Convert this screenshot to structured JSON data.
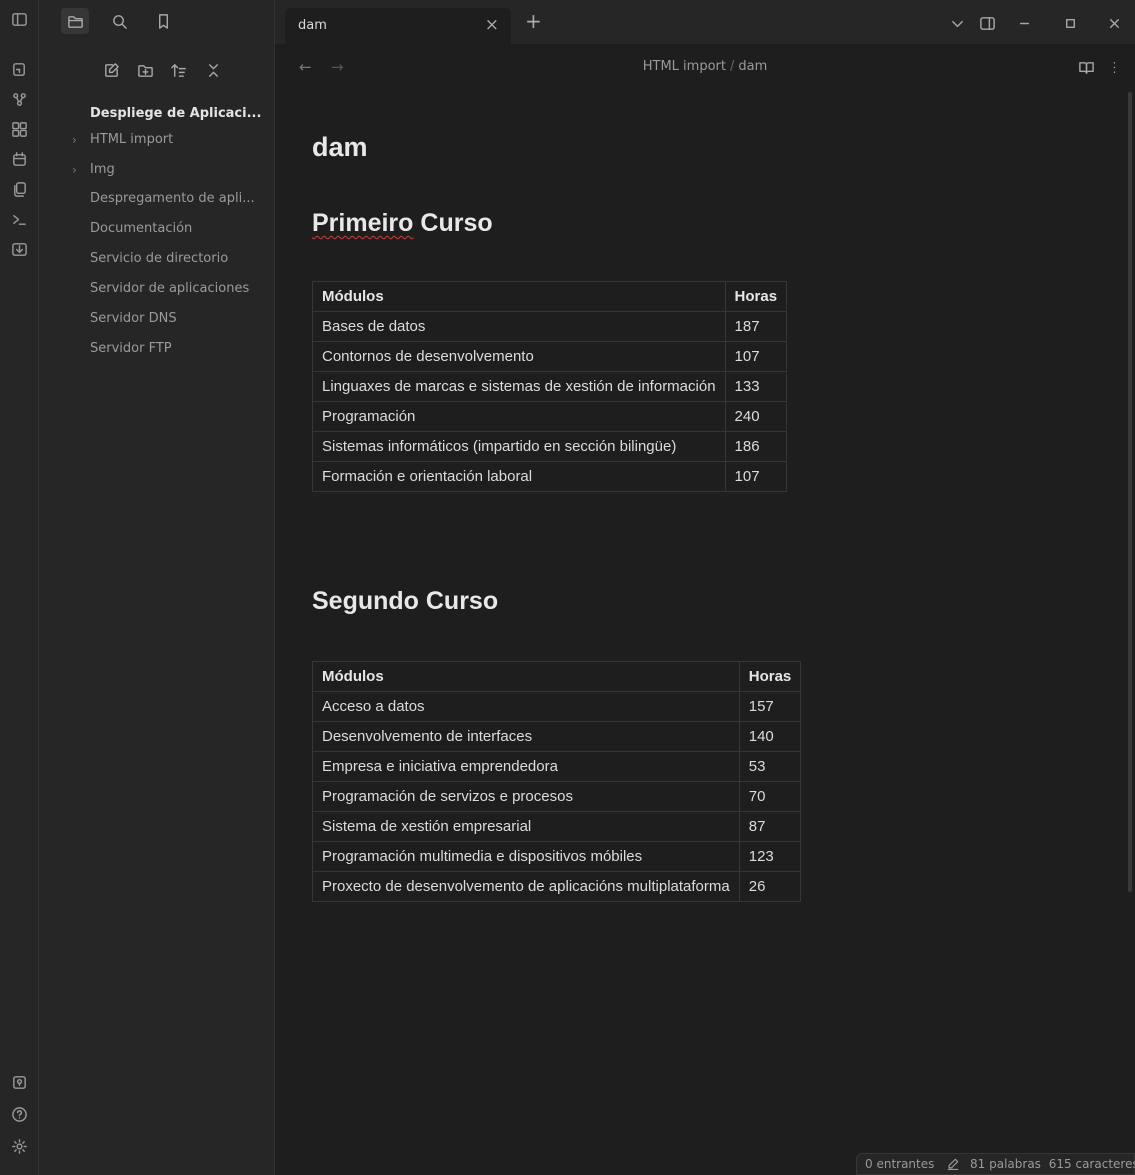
{
  "ribbon": {
    "top_icons": [
      "switcher-icon",
      "graph-icon",
      "canvas-icon",
      "calendar-icon",
      "templates-icon",
      "terminal-icon",
      "import-icon"
    ],
    "bottom_icons": [
      "vault-icon",
      "help-icon",
      "settings-icon"
    ]
  },
  "sidebar": {
    "tabs": [
      "files-icon",
      "search-icon",
      "bookmarks-icon"
    ],
    "actions": [
      "new-note-icon",
      "new-folder-icon",
      "sort-icon",
      "collapse-icon"
    ],
    "root": "Despliege de Aplicaci...",
    "items": [
      {
        "label": "HTML import",
        "folder": true
      },
      {
        "label": "Img",
        "folder": true
      },
      {
        "label": "Despregamento de apli...",
        "folder": false
      },
      {
        "label": "Documentación",
        "folder": false
      },
      {
        "label": "Servicio de directorio",
        "folder": false
      },
      {
        "label": "Servidor de aplicaciones",
        "folder": false
      },
      {
        "label": "Servidor DNS",
        "folder": false
      },
      {
        "label": "Servidor FTP",
        "folder": false
      }
    ]
  },
  "tabbar": {
    "tab_title": "dam",
    "close": "×",
    "new_tab": "+"
  },
  "header": {
    "breadcrumb_parent": "HTML import",
    "breadcrumb_sep": "/",
    "breadcrumb_current": "dam"
  },
  "document": {
    "title": "dam",
    "sections": [
      {
        "heading": "Primeiro Curso",
        "columns": [
          "Módulos",
          "Horas"
        ],
        "rows": [
          [
            "Bases de datos",
            "187"
          ],
          [
            "Contornos de desenvolvemento",
            "107"
          ],
          [
            "Linguaxes de marcas e sistemas de xestión de información",
            "133"
          ],
          [
            "Programación",
            "240"
          ],
          [
            "Sistemas informáticos (impartido en sección bilingüe)",
            "186"
          ],
          [
            "Formación e orientación laboral",
            "107"
          ]
        ]
      },
      {
        "heading": "Segundo Curso",
        "columns": [
          "Módulos",
          "Horas"
        ],
        "rows": [
          [
            "Acceso a datos",
            "157"
          ],
          [
            "Desenvolvemento de interfaces",
            "140"
          ],
          [
            "Empresa e iniciativa emprendedora",
            "53"
          ],
          [
            "Programación de servizos e procesos",
            "70"
          ],
          [
            "Sistema de xestión empresarial",
            "87"
          ],
          [
            "Programación multimedia e dispositivos móbiles",
            "123"
          ],
          [
            "Proxecto de desenvolvemento de aplicacións multiplataforma",
            "26"
          ]
        ]
      }
    ]
  },
  "status": {
    "backlinks": "0 entrantes",
    "words": "81 palabras",
    "chars": "615 caracteres"
  }
}
